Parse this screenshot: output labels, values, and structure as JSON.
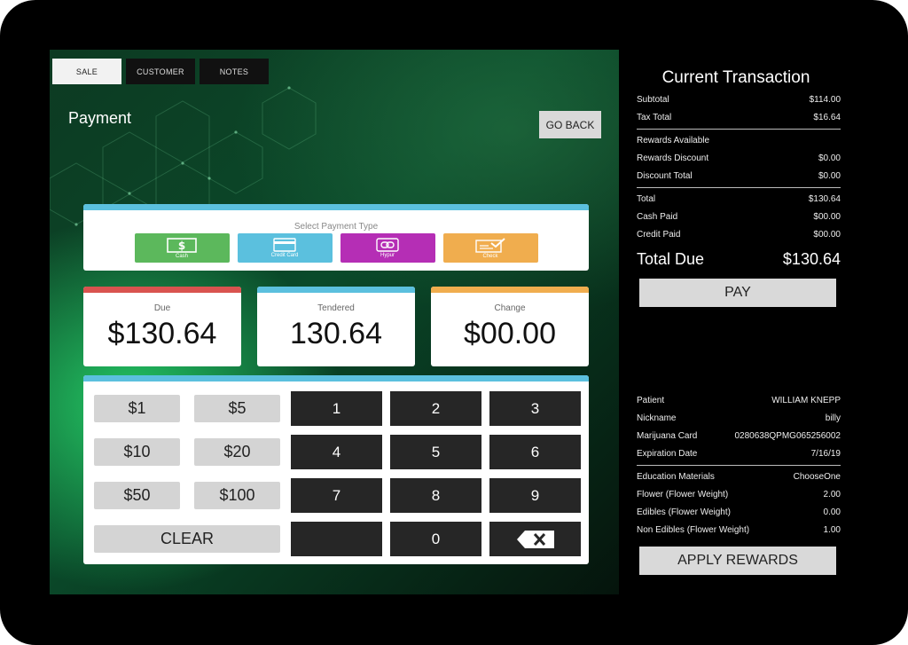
{
  "tabs": [
    {
      "label": "SALE",
      "active": true
    },
    {
      "label": "CUSTOMER",
      "active": false
    },
    {
      "label": "NOTES",
      "active": false
    }
  ],
  "payment": {
    "title": "Payment",
    "go_back_label": "GO BACK",
    "select_type_title": "Select Payment Type",
    "types": [
      {
        "label": "Cash",
        "color": "#5cb85c",
        "icon": "cash-icon"
      },
      {
        "label": "Credit Card",
        "color": "#5bc0de",
        "icon": "credit-card-icon"
      },
      {
        "label": "Hypur",
        "color": "#b52eb5",
        "icon": "hypur-icon"
      },
      {
        "label": "Check",
        "color": "#f0ad4e",
        "icon": "check-icon"
      }
    ]
  },
  "totals": {
    "due": {
      "label": "Due",
      "value": "$130.64",
      "color": "#d9534f"
    },
    "tendered": {
      "label": "Tendered",
      "value": "130.64",
      "color": "#5bc0de"
    },
    "change": {
      "label": "Change",
      "value": "$00.00",
      "color": "#f0ad4e"
    }
  },
  "keypad": {
    "accent": "#5bc0de",
    "quick_amounts": [
      "$1",
      "$5",
      "$10",
      "$20",
      "$50",
      "$100"
    ],
    "clear_label": "CLEAR",
    "digits": [
      "1",
      "2",
      "3",
      "4",
      "5",
      "6",
      "7",
      "8",
      "9",
      "0"
    ],
    "backspace_icon": "backspace-icon"
  },
  "transaction": {
    "title": "Current Transaction",
    "subtotal": {
      "label": "Subtotal",
      "value": "$114.00"
    },
    "tax_total": {
      "label": "Tax Total",
      "value": "$16.64"
    },
    "rewards_available": {
      "label": "Rewards Available"
    },
    "rewards_discount": {
      "label": "Rewards Discount",
      "value": "$0.00"
    },
    "discount_total": {
      "label": "Discount Total",
      "value": "$0.00"
    },
    "total": {
      "label": "Total",
      "value": "$130.64"
    },
    "cash_paid": {
      "label": "Cash Paid",
      "value": "$00.00"
    },
    "credit_paid": {
      "label": "Credit Paid",
      "value": "$00.00"
    },
    "total_due": {
      "label": "Total Due",
      "value": "$130.64"
    },
    "pay_label": "PAY"
  },
  "patient": {
    "patient": {
      "label": "Patient",
      "value": "WILLIAM KNEPP"
    },
    "nickname": {
      "label": "Nickname",
      "value": "billy"
    },
    "card": {
      "label": "Marijuana Card",
      "value": "0280638QPMG065256002"
    },
    "expiration": {
      "label": "Expiration Date",
      "value": "7/16/19"
    },
    "education": {
      "label": "Education Materials",
      "value": "ChooseOne"
    },
    "flower": {
      "label": "Flower (Flower Weight)",
      "value": "2.00"
    },
    "edibles": {
      "label": "Edibles (Flower Weight)",
      "value": "0.00"
    },
    "non_edibles": {
      "label": "Non Edibles (Flower Weight)",
      "value": "1.00"
    },
    "apply_rewards_label": "APPLY REWARDS"
  }
}
